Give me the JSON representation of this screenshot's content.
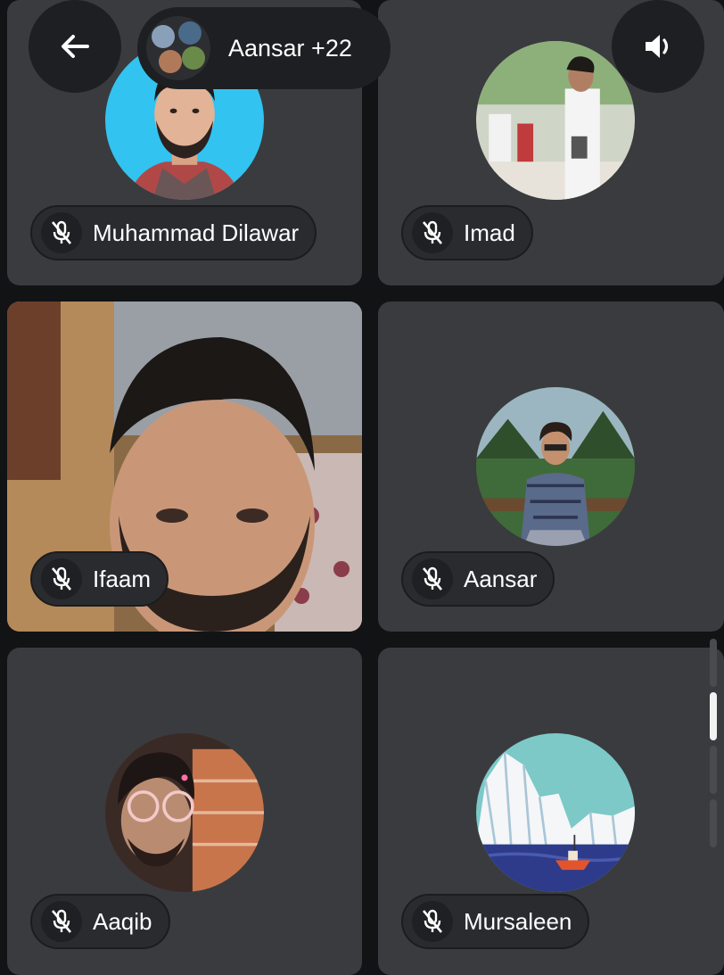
{
  "header": {
    "back_icon": "arrow-left-icon",
    "group_label": "Aansar +22",
    "speaker_icon": "speaker-icon"
  },
  "participants": [
    {
      "name": "Muhammad Dilawar",
      "muted": true,
      "media": "avatar"
    },
    {
      "name": "Imad",
      "muted": true,
      "media": "avatar"
    },
    {
      "name": "Ifaam",
      "muted": true,
      "media": "video"
    },
    {
      "name": "Aansar",
      "muted": true,
      "media": "avatar"
    },
    {
      "name": "Aaqib",
      "muted": true,
      "media": "avatar"
    },
    {
      "name": "Mursaleen",
      "muted": true,
      "media": "avatar"
    }
  ],
  "icons": {
    "muted_mic": "mic-off-icon"
  },
  "colors": {
    "background": "#121314",
    "tile": "#3a3b3e",
    "pill": "#2a2b2e"
  }
}
